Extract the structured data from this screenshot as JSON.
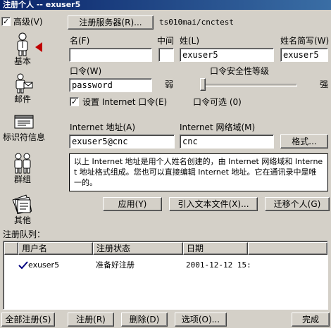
{
  "window": {
    "title": "注册个人 -- exuser5"
  },
  "sidebar": {
    "advanced_label": "高级(V)",
    "advanced_checked": true,
    "items": [
      {
        "label": "基本",
        "icon": "person-icon",
        "selected": true
      },
      {
        "label": "邮件",
        "icon": "mail-person-icon"
      },
      {
        "label": "标识符信息",
        "icon": "id-card-icon"
      },
      {
        "label": "群组",
        "icon": "group-icon"
      },
      {
        "label": "其他",
        "icon": "files-icon"
      }
    ]
  },
  "form": {
    "register_server_label": "注册服务器(R)...",
    "server_name": "ts010mai/cnctest",
    "first_name_label": "名(F)",
    "first_name_value": "",
    "middle_label": "中间",
    "middle_value": "",
    "last_name_label": "姓(L)",
    "last_name_value": "exuser5",
    "short_name_label": "姓名简写(W)",
    "short_name_value": "exuser5",
    "password_label": "口令(W)",
    "password_value": "password",
    "security_label": "口令安全性等级",
    "security_weak": "弱",
    "security_strong": "强",
    "security_level": 0.0,
    "set_internet_pw_label": "设置 Internet 口令(E)",
    "set_internet_pw_checked": true,
    "pw_optional_label": "口令可选  (0)",
    "internet_addr_label": "Internet 地址(A)",
    "internet_addr_value": "exuser5@cnc",
    "internet_domain_label": "Internet 网络域(M)",
    "internet_domain_value": "cnc",
    "format_button": "格式...",
    "info_text": "以上 Internet 地址是用个人姓名创建的，由 Internet 网络域和 Internet 地址格式组成。您也可以直接编辑 Internet 地址。它在通讯录中是唯一的。"
  },
  "actions": {
    "apply": "应用(Y)",
    "import_text": "引入文本文件(X)...",
    "migrate": "迁移个人(G)"
  },
  "queue": {
    "label": "注册队列：",
    "columns": [
      "用户名",
      "注册状态",
      "日期"
    ],
    "rows": [
      {
        "user": "exuser5",
        "status": "准备好注册",
        "date": "2001-12-12 15:"
      }
    ]
  },
  "footer": {
    "register_all": "全部注册(S)",
    "register": "注册(R)",
    "delete": "删除(D)",
    "options": "选项(O)...",
    "done": "完成"
  }
}
